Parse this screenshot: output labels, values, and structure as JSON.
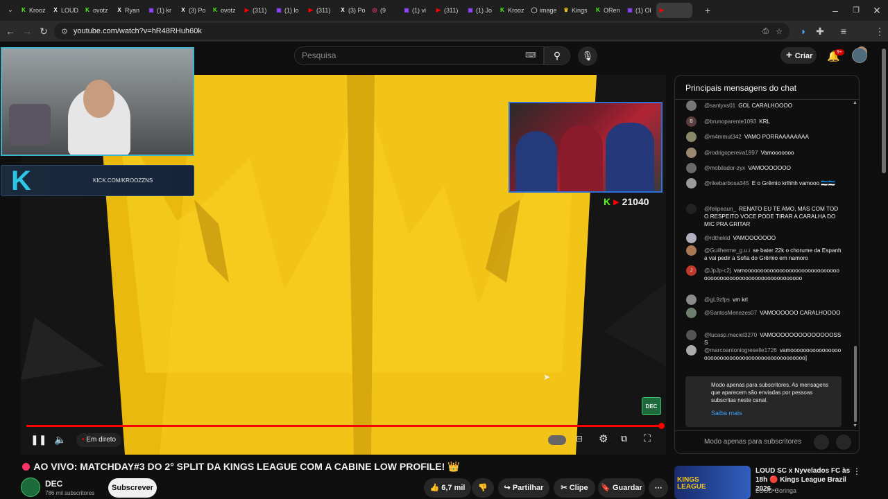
{
  "browser": {
    "tabs": [
      {
        "label": "Krooz",
        "fav": "K",
        "color": "#53fc18"
      },
      {
        "label": "LOUD",
        "fav": "X",
        "color": "#ffffff"
      },
      {
        "label": "ovotz",
        "fav": "K",
        "color": "#53fc18"
      },
      {
        "label": "Ryan",
        "fav": "X",
        "color": "#ffffff"
      },
      {
        "label": "(1) kr",
        "fav": "▣",
        "color": "#9146ff"
      },
      {
        "label": "(3) Po",
        "fav": "X",
        "color": "#ffffff"
      },
      {
        "label": "ovotz",
        "fav": "K",
        "color": "#53fc18"
      },
      {
        "label": "(311)",
        "fav": "▶",
        "color": "#ff0000"
      },
      {
        "label": "(1) lo",
        "fav": "▣",
        "color": "#9146ff"
      },
      {
        "label": "(311)",
        "fav": "▶",
        "color": "#ff0000"
      },
      {
        "label": "(3) Po",
        "fav": "X",
        "color": "#ffffff"
      },
      {
        "label": "(9",
        "fav": "◎",
        "color": "#e1306c"
      },
      {
        "label": "(1) vi",
        "fav": "▣",
        "color": "#9146ff"
      },
      {
        "label": "(311)",
        "fav": "▶",
        "color": "#ff0000"
      },
      {
        "label": "(1) Jo",
        "fav": "▣",
        "color": "#9146ff"
      },
      {
        "label": "Krooz",
        "fav": "K",
        "color": "#53fc18"
      },
      {
        "label": "image",
        "fav": "◯",
        "color": "#cccccc"
      },
      {
        "label": "Kings",
        "fav": "♛",
        "color": "#f5c518"
      },
      {
        "label": "ORen",
        "fav": "K",
        "color": "#53fc18"
      },
      {
        "label": "(1) Ol",
        "fav": "▣",
        "color": "#9146ff"
      },
      {
        "label": "",
        "fav": "▶",
        "color": "#ff0000"
      }
    ],
    "url": "youtube.com/watch?v=hR48RHuh60k"
  },
  "header": {
    "search_placeholder": "Pesquisa",
    "create_label": "Criar",
    "notif_badge": "9+"
  },
  "video": {
    "cam_banner": "KICK.COM/KROOZZNS",
    "viewer_count": "21040",
    "live_label": "Em direto",
    "watermark": "DEC"
  },
  "chat": {
    "header": "Principais mensagens do chat",
    "messages": [
      {
        "author": "@santyxs01",
        "text": "GOL CARALHOOOO",
        "avatar_color": "#777"
      },
      {
        "author": "@brunoparente1093",
        "text": "KRL",
        "avatar_color": "#5a3d3d",
        "initial": "B"
      },
      {
        "author": "@m4mmut342",
        "text": "VAMO PORRAAAAAAAA",
        "avatar_color": "#8a8a6a"
      },
      {
        "author": "@rodrigopereira1897",
        "text": "Vamooooooo",
        "avatar_color": "#9a8870"
      },
      {
        "author": "@mobilador-zyx",
        "text": "VAMOOOOOOO",
        "avatar_color": "#6a6a6a"
      },
      {
        "author": "@rikebarbosa345",
        "text": "E o Grêmio krlhhh vamooo 🇪🇪🇪🇪",
        "avatar_color": "#999"
      },
      {
        "author": "@felipeaun_",
        "text": "RENATO EU TE AMO, MAS COM TODO RESPEITO VOCE PODE TIRAR A CARALHA DO MIC PRA GRITAR",
        "avatar_color": "#222"
      },
      {
        "author": "@rdthekid",
        "text": "VAMOOOOOOO",
        "avatar_color": "#b0b0c0"
      },
      {
        "author": "@Guilherme_g.u.i",
        "text": "se bater 22k o chorume da Espanha vai pedir a Sofia do Grêmio em namoro",
        "avatar_color": "#aa7755"
      },
      {
        "author": "@JpJp-c2j",
        "text": "vamooooooooooooooooooooooooooooooooooooooooooooooooooooooooooooo",
        "avatar_color": "#c0392b",
        "initial": "J"
      },
      {
        "author": "@gL9zfps",
        "text": "vm krl",
        "avatar_color": "#8a8a8a"
      },
      {
        "author": "@SantosMenezes07",
        "text": "VAMOOOOOO CARALHOOOO",
        "avatar_color": "#6f7f6f"
      },
      {
        "author": "@lucasp.maciel3270",
        "text": "VAMOOOOOOOOOOOOOOSSS",
        "avatar_color": "#555"
      },
      {
        "author": "@marcoantoniogreselle1726",
        "text": "vamoooooooooooooooooooooooooooooooooooooooooooooooo]",
        "avatar_color": "#aaa"
      }
    ],
    "notice_text": "Modo apenas para subscritores. As mensagens que aparecem são enviadas por pessoas subscritas neste canal.",
    "notice_link": "Saiba mais",
    "footer": "Modo apenas para subscritores"
  },
  "below": {
    "title": "AO VIVO: MATCHDAY#3 DO 2° SPLIT DA KINGS LEAGUE COM A CABINE LOW PROFILE! 👑",
    "channel": "DEC",
    "subs": "786 mil subscritores",
    "subscribe": "Subscrever",
    "likes": "6,7 mil",
    "share": "Partilhar",
    "clip": "Clipe",
    "save": "Guardar"
  },
  "suggested": {
    "title": "LOUD SC x Nyvelados FC às 18h 🔴 Kings League Brazil 2026 ...",
    "channel": "LOUD Coringa",
    "thumb_label": "KINGS LEAGUE"
  },
  "colors": {
    "accent": "#ff0000",
    "gold": "#f2c418",
    "kick": "#53fc18",
    "link": "#3ea6ff"
  }
}
